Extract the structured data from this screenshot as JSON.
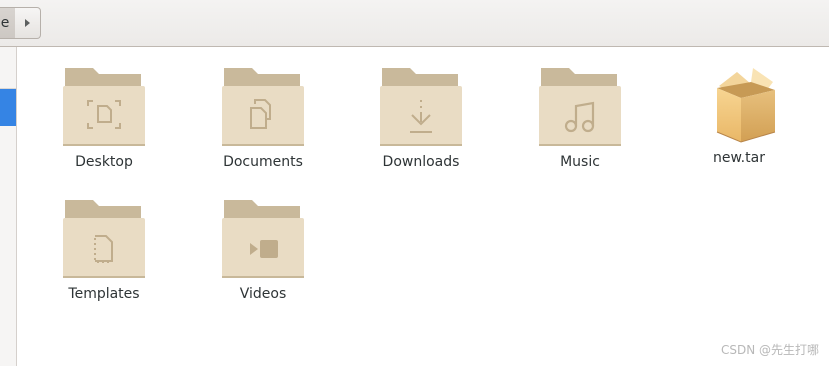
{
  "header": {
    "home_fragment": "e"
  },
  "items": [
    {
      "label": "Desktop",
      "icon": "folder-desktop-icon"
    },
    {
      "label": "Documents",
      "icon": "folder-documents-icon"
    },
    {
      "label": "Downloads",
      "icon": "folder-downloads-icon"
    },
    {
      "label": "Music",
      "icon": "folder-music-icon"
    },
    {
      "label": "new.tar",
      "icon": "archive-box-icon"
    },
    {
      "label": "Templates",
      "icon": "folder-templates-icon"
    },
    {
      "label": "Videos",
      "icon": "folder-videos-icon"
    }
  ],
  "colors": {
    "folder_back": "#c9b99b",
    "folder_front": "#e9dcc4",
    "folder_glyph": "#c0ad8c",
    "selection": "#3584e4"
  },
  "watermark": "CSDN @先生打哪"
}
